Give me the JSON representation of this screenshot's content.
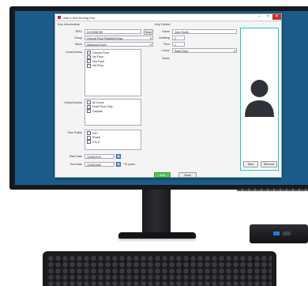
{
  "window": {
    "title": "Add a new touring Key",
    "minimize": "–",
    "maximize": "□",
    "close": "✕"
  },
  "key_info": {
    "header": "Key Information",
    "rfid_label": "RFID",
    "rfid_value": "0123456789",
    "scan_label": "Scan",
    "group_label": "Group",
    "group_value": "Ground Floor Resident Keys",
    "block_label": "Block",
    "block_value": "Ashwood Court",
    "local_access_label": "Local Access",
    "local_access": [
      {
        "label": "Ground Floor",
        "checked": true
      },
      {
        "label": "1st Floor",
        "checked": true
      },
      {
        "label": "2nd Floor",
        "checked": false
      },
      {
        "label": "3rd Floor",
        "checked": false
      }
    ],
    "global_access_label": "Global Access",
    "global_access": [
      {
        "label": "All Doors",
        "checked": false
      },
      {
        "label": "Front Door Only",
        "checked": true
      },
      {
        "label": "Carpark",
        "checked": true
      }
    ],
    "time_profile_label": "Time Profile",
    "time_profiles": [
      {
        "label": "24/7",
        "checked": true
      },
      {
        "label": "Postal",
        "checked": false
      },
      {
        "label": "9 to 5",
        "checked": false
      }
    ],
    "start_date_label": "Start Date",
    "start_date_value": "12/08/2019",
    "end_date_label": "End Date",
    "end_date_value": "12/08/2089",
    "duration_text": "~70 years"
  },
  "key_holder": {
    "header": "Key Holder",
    "name_label": "Name",
    "name_value": "John Smith",
    "dwelling_label": "Dwelling",
    "dwelling_value": "2",
    "floor_label": "Floor",
    "floor_value": "1",
    "colour_label": "Colour",
    "colour_value": "Solid Grey",
    "notes_label": "Notes"
  },
  "photo": {
    "icon": "user-silhouette-icon",
    "new_label": "New",
    "remove_label": "Remove"
  },
  "actions": {
    "add_label": "Add",
    "close_label": "Close"
  },
  "colors": {
    "desktop": "#1d5c8a",
    "add_button": "#58c458",
    "photo_border": "#19c6d6"
  }
}
